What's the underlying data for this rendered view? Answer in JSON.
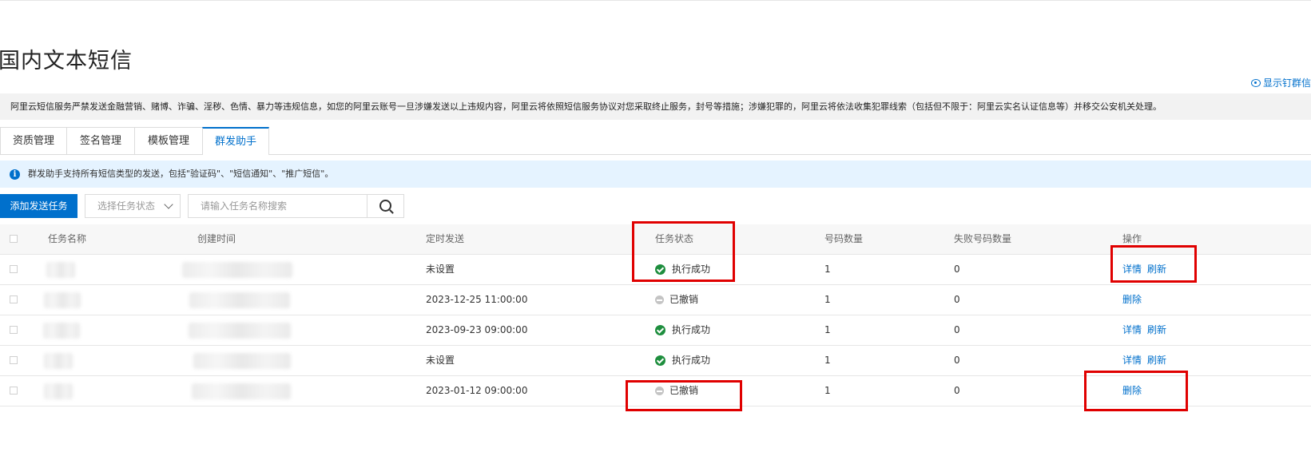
{
  "page": {
    "title": "国内文本短信",
    "top_link": "显示钉群信",
    "warning": "阿里云短信服务严禁发送金融营销、赌博、诈骗、淫秽、色情、暴力等违规信息，如您的阿里云账号一旦涉嫌发送以上违规内容，阿里云将依照短信服务协议对您采取终止服务，封号等措施；涉嫌犯罪的，阿里云将依法收集犯罪线索（包括但不限于：阿里云实名认证信息等）并移交公安机关处理。"
  },
  "tabs": [
    {
      "label": "资质管理",
      "active": false
    },
    {
      "label": "签名管理",
      "active": false
    },
    {
      "label": "模板管理",
      "active": false
    },
    {
      "label": "群发助手",
      "active": true
    }
  ],
  "notice": "群发助手支持所有短信类型的发送，包括\"验证码\"、\"短信通知\"、\"推广短信\"。",
  "toolbar": {
    "add_button": "添加发送任务",
    "status_select": "选择任务状态",
    "search_placeholder": "请输入任务名称搜索"
  },
  "table": {
    "headers": [
      "任务名称",
      "创建时间",
      "定时发送",
      "任务状态",
      "号码数量",
      "失败号码数量",
      "操作"
    ],
    "rows": [
      {
        "schedule": "未设置",
        "status": "执行成功",
        "status_type": "success",
        "count": "1",
        "failed": "0",
        "actions": [
          "详情",
          "刷新"
        ]
      },
      {
        "schedule": "2023-12-25 11:00:00",
        "status": "已撤销",
        "status_type": "cancelled",
        "count": "1",
        "failed": "0",
        "actions": [
          "删除"
        ]
      },
      {
        "schedule": "2023-09-23 09:00:00",
        "status": "执行成功",
        "status_type": "success",
        "count": "1",
        "failed": "0",
        "actions": [
          "详情",
          "刷新"
        ]
      },
      {
        "schedule": "未设置",
        "status": "执行成功",
        "status_type": "success",
        "count": "1",
        "failed": "0",
        "actions": [
          "详情",
          "刷新"
        ]
      },
      {
        "schedule": "2023-01-12 09:00:00",
        "status": "已撤销",
        "status_type": "cancelled",
        "count": "1",
        "failed": "0",
        "actions": [
          "删除"
        ]
      }
    ]
  },
  "colors": {
    "accent": "#0070cc",
    "success": "#1e8e3e",
    "cancelled": "#c4c4c4",
    "highlight": "#e00000"
  }
}
